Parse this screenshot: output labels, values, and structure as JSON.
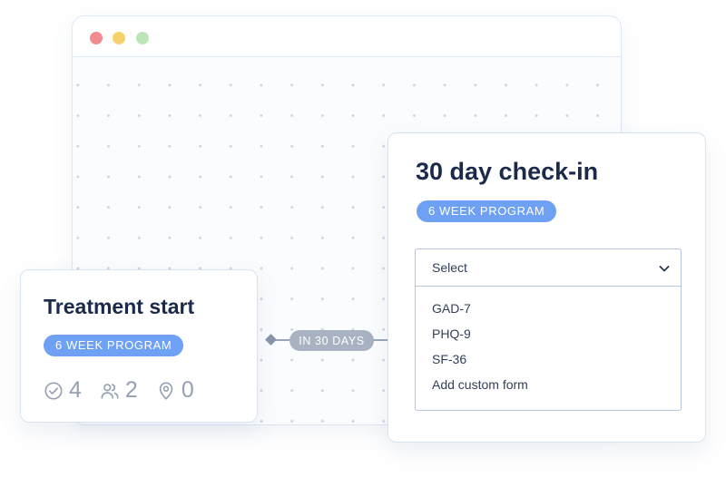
{
  "left_card": {
    "title": "Treatment start",
    "badge": "6 WEEK PROGRAM",
    "stats": {
      "checks": "4",
      "people": "2",
      "locations": "0"
    }
  },
  "connector": {
    "label": "IN 30 DAYS"
  },
  "right_card": {
    "title": "30 day check-in",
    "badge": "6 WEEK PROGRAM",
    "dropdown": {
      "value": "Select",
      "options": [
        "GAD-7",
        "PHQ-9",
        "SF-36",
        "Add custom form"
      ]
    }
  },
  "colors": {
    "accent": "#6ea1f3",
    "title": "#1b2a4a",
    "muted": "#95a0b3"
  },
  "icons": {
    "check": "check-circle-icon",
    "people": "users-icon",
    "location": "map-pin-icon",
    "chevron": "chevron-down-icon"
  }
}
